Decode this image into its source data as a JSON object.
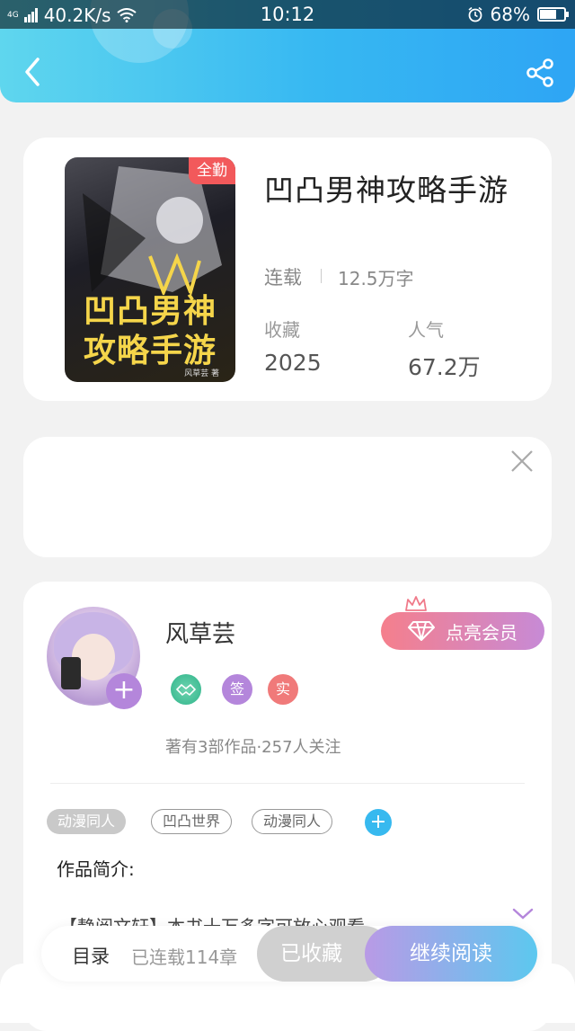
{
  "status_bar": {
    "network": "4G",
    "speed": "40.2K/s",
    "time": "10:12",
    "battery_percent": "68%",
    "battery_level": 0.68
  },
  "header": {
    "back_icon": "chevron-left-icon",
    "share_icon": "share-icon"
  },
  "book": {
    "cover_badge": "全勤",
    "cover_title_line1": "凹凸男神",
    "cover_title_line2": "攻略手游",
    "cover_author": "风草芸 著",
    "title": "凹凸男神攻略手游",
    "status": "连载",
    "word_count": "12.5万字",
    "stats": [
      {
        "label": "收藏",
        "value": "2025"
      },
      {
        "label": "人气",
        "value": "67.2万"
      }
    ]
  },
  "author": {
    "name": "风草芸",
    "follow_plus": "+",
    "vip_button": "点亮会员",
    "badges": [
      {
        "icon": "handshake-icon",
        "text": ""
      },
      {
        "icon": "sign-badge",
        "text": "签",
        "color": "#b486db"
      },
      {
        "icon": "verified-badge",
        "text": "实",
        "color": "#f07a7a"
      }
    ],
    "meta": "著有3部作品·257人关注",
    "tags": [
      "动漫同人",
      "凹凸世界",
      "动漫同人"
    ],
    "tag_add": "+",
    "intro_label": "作品简介:",
    "intro_text": "【静阅文轩】本书十万多字可放心观看"
  },
  "bottom_bar": {
    "toc": "目录",
    "chapter_count": "已连载114章",
    "favorite_button": "已收藏",
    "read_button": "继续阅读"
  },
  "colors": {
    "header_start": "#5fd6ee",
    "header_end": "#2ea5f4",
    "accent_purple": "#b486db",
    "accent_blue": "#37b9ef"
  }
}
